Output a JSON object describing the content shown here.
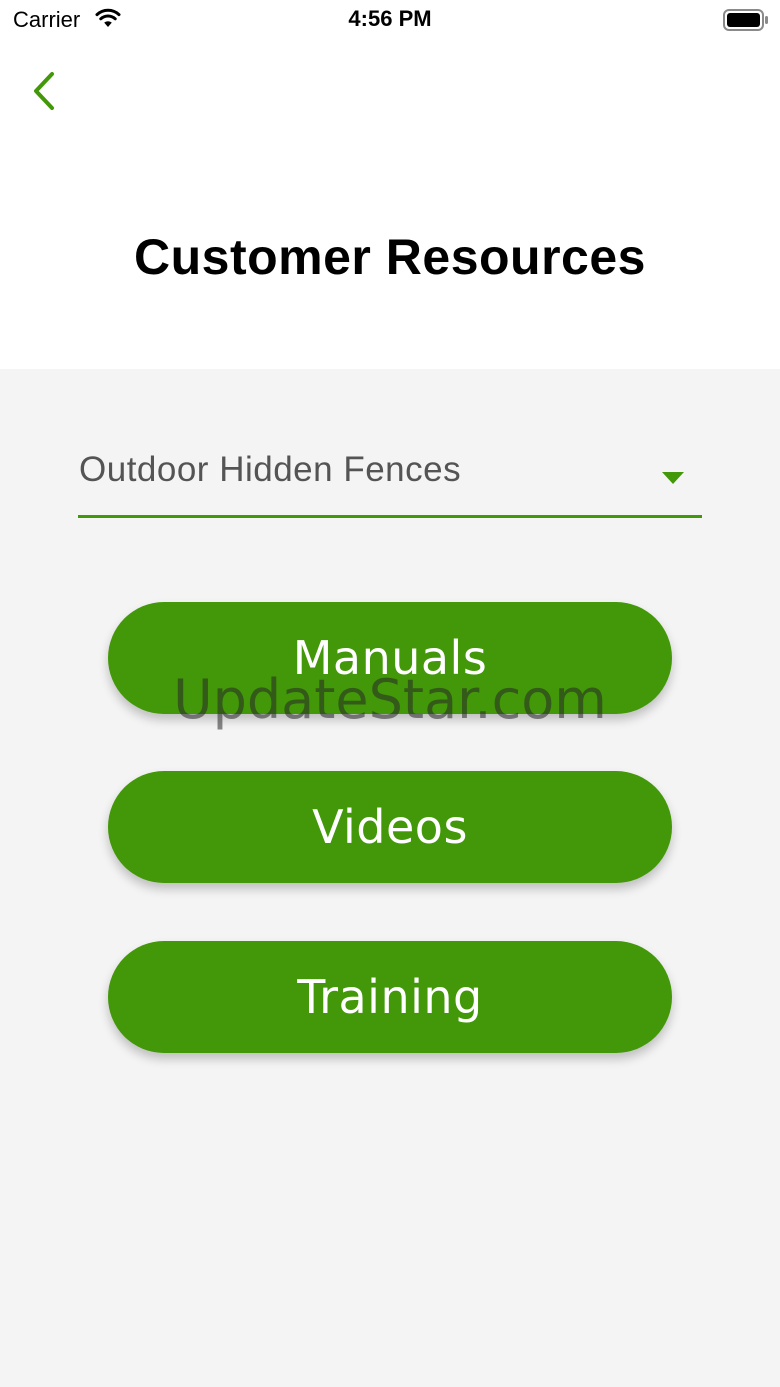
{
  "status_bar": {
    "carrier": "Carrier",
    "time": "4:56 PM"
  },
  "header": {
    "title": "Customer Resources"
  },
  "dropdown": {
    "selected": "Outdoor Hidden Fences"
  },
  "buttons": {
    "manuals": "Manuals",
    "videos": "Videos",
    "training": "Training"
  },
  "watermark": "UpdateStar.com",
  "colors": {
    "accent": "#429808",
    "background": "#f4f4f4",
    "header_background": "#ffffff"
  }
}
